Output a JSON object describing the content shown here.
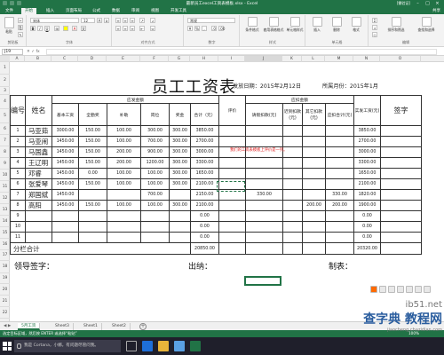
{
  "window": {
    "title": "最新员工excel工资表模板.xlsx - Excel",
    "account": "[需验证]",
    "colors": {
      "accent": "#217346",
      "note": "#e02020"
    }
  },
  "ribbon_tabs": [
    "文件",
    "开始",
    "插入",
    "页面布局",
    "公式",
    "数据",
    "审阅",
    "视图",
    "开发工具"
  ],
  "share_label": "共享",
  "ribbon": {
    "paste": "粘贴",
    "clipboard": "剪贴板",
    "font_name": "宋体",
    "font_size": "12",
    "font_group": "字体",
    "align_group": "对齐方式",
    "number_format": "常规",
    "number_group": "数字",
    "conditional": "条件格式",
    "table_format": "套用表格格式",
    "cell_style": "单元格样式",
    "style_group": "样式",
    "insert": "插入",
    "delete": "删除",
    "format": "格式",
    "cells_group": "单元格",
    "sort": "排序和筛选",
    "find": "查找和选择",
    "edit_group": "编辑"
  },
  "formula_bar": {
    "name_box": "J19",
    "fx": "fx",
    "value": ""
  },
  "columns": [
    "A",
    "B",
    "C",
    "D",
    "E",
    "F",
    "G",
    "H",
    "I",
    "J",
    "K",
    "L",
    "M",
    "N",
    "O"
  ],
  "rows": [
    "1",
    "2",
    "3",
    "4",
    "5",
    "6",
    "7",
    "8",
    "9",
    "10",
    "11",
    "12",
    "13",
    "14",
    "15",
    "16",
    "17",
    "18",
    "19",
    "20",
    "21",
    "22"
  ],
  "sheet": {
    "title": "员工工资表",
    "issue_date": "发放日期：2015年2月12日",
    "month": "所属月份：2015年1月",
    "headers": {
      "no": "编号",
      "name": "姓名",
      "payable": "应发金额",
      "base": "基本工资",
      "allowance": "全勤奖",
      "subsidy": "补助",
      "post": "岗位",
      "bonus": "奖金",
      "total_payable": "合计（元）",
      "review": "评价",
      "deduct": "应扣金额",
      "leave": "请假扣款(元)",
      "late": "迟到扣款(元)",
      "other": "其它扣款(元)",
      "deduct_total": "应扣合计(元)",
      "actual": "实发工资(元)",
      "signature": "签字"
    },
    "rows": [
      {
        "no": "1",
        "name": "马亚茹",
        "base": "3000.00",
        "allowance": "150.00",
        "subsidy": "100.00",
        "post": "300.00",
        "bonus": "300.00",
        "total": "3850.00",
        "leave": "",
        "late": "",
        "other": "",
        "deduct": "",
        "actual": "3850.00"
      },
      {
        "no": "2",
        "name": "马亚闹",
        "base": "1450.00",
        "allowance": "150.00",
        "subsidy": "100.00",
        "post": "700.00",
        "bonus": "300.00",
        "total": "2700.00",
        "leave": "",
        "late": "",
        "other": "",
        "deduct": "",
        "actual": "2700.00"
      },
      {
        "no": "3",
        "name": "马国鑫",
        "base": "1450.00",
        "allowance": "150.00",
        "subsidy": "200.00",
        "post": "900.00",
        "bonus": "300.00",
        "total": "3000.00",
        "leave": "",
        "late": "",
        "other": "",
        "deduct": "",
        "actual": "3000.00"
      },
      {
        "no": "4",
        "name": "王辽明",
        "base": "1450.00",
        "allowance": "150.00",
        "subsidy": "200.00",
        "post": "1200.00",
        "bonus": "300.00",
        "total": "3300.00",
        "leave": "",
        "late": "",
        "other": "",
        "deduct": "",
        "actual": "3300.00"
      },
      {
        "no": "5",
        "name": "邓睿",
        "base": "1450.00",
        "allowance": "0.00",
        "subsidy": "100.00",
        "post": "100.00",
        "bonus": "300.00",
        "total": "1650.00",
        "leave": "",
        "late": "",
        "other": "",
        "deduct": "",
        "actual": "1650.00"
      },
      {
        "no": "6",
        "name": "张爱琴",
        "base": "1450.00",
        "allowance": "150.00",
        "subsidy": "100.00",
        "post": "100.00",
        "bonus": "300.00",
        "total": "2100.00",
        "leave": "",
        "late": "",
        "other": "",
        "deduct": "",
        "actual": "2100.00"
      },
      {
        "no": "7",
        "name": "郑国斌",
        "base": "1450.00",
        "allowance": "",
        "subsidy": "",
        "post": "700.00",
        "bonus": "",
        "total": "2150.00",
        "leave": "330.00",
        "late": "",
        "other": "",
        "deduct": "330.00",
        "actual": "1820.00"
      },
      {
        "no": "8",
        "name": "高阳",
        "base": "1450.00",
        "allowance": "150.00",
        "subsidy": "100.00",
        "post": "100.00",
        "bonus": "300.00",
        "total": "2100.00",
        "leave": "",
        "late": "",
        "other": "200.00",
        "deduct": "200.00",
        "actual": "1900.00"
      },
      {
        "no": "9",
        "name": "",
        "base": "",
        "allowance": "",
        "subsidy": "",
        "post": "",
        "bonus": "",
        "total": "0.00",
        "leave": "",
        "late": "",
        "other": "",
        "deduct": "",
        "actual": "0.00"
      },
      {
        "no": "10",
        "name": "",
        "base": "",
        "allowance": "",
        "subsidy": "",
        "post": "",
        "bonus": "",
        "total": "0.00",
        "leave": "",
        "late": "",
        "other": "",
        "deduct": "",
        "actual": "0.00"
      },
      {
        "no": "11",
        "name": "",
        "base": "",
        "allowance": "",
        "subsidy": "",
        "post": "",
        "bonus": "",
        "total": "0.00",
        "leave": "",
        "late": "",
        "other": "",
        "deduct": "",
        "actual": "0.00"
      }
    ],
    "subtotal_label": "分栏合计",
    "subtotal_total": "20850.00",
    "subtotal_actual": "20320.00",
    "note": "我们的工资表模板上评价是一列。",
    "leader_sign": "领导签字：",
    "cashier": "出纳：",
    "preparer": "制表："
  },
  "sheet_tabs": [
    "5月工资",
    "Sheet3",
    "Sheet1",
    "Sheet2"
  ],
  "status": {
    "left": "选定目标区域，然后按 ENTER 或选择“粘贴”",
    "zoom": "100%"
  },
  "taskbar": {
    "search_placeholder": "我是 Cortana，小娜。有问题尽管问我。"
  },
  "watermark": {
    "line1": "ib51.net",
    "line2": "查字典 教程网",
    "line3": "jiaocheng.chazidian.com"
  }
}
